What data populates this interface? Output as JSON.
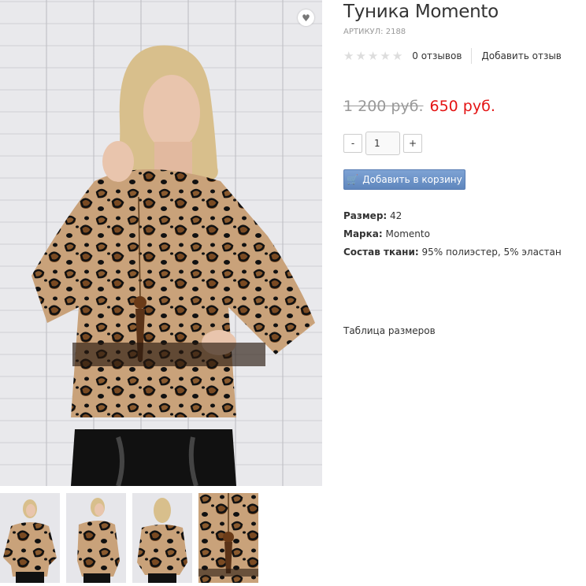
{
  "product": {
    "title": "Туника Momento",
    "sku": "АРТИКУЛ: 2188",
    "reviews_count": "0 отзывов",
    "add_review": "Добавить отзыв",
    "rating": 0,
    "rating_max": 5,
    "old_price": "1 200 руб.",
    "new_price": "650 руб.",
    "quantity": "1",
    "minus_label": "-",
    "plus_label": "+",
    "add_to_cart": "Добавить в корзину",
    "attributes": [
      {
        "name": "Размер:",
        "value": "42"
      },
      {
        "name": "Марка:",
        "value": "Momento"
      },
      {
        "name": "Состав ткани:",
        "value": "95% полиэстер, 5% эластан"
      }
    ],
    "size_table_link": "Таблица размеров"
  },
  "icons": {
    "favorite": "heart-icon",
    "cart": "cart-icon",
    "star": "star-icon"
  },
  "colors": {
    "accent": "#5f86bd",
    "sale_price": "#e41414",
    "star_empty": "#dddddd"
  }
}
